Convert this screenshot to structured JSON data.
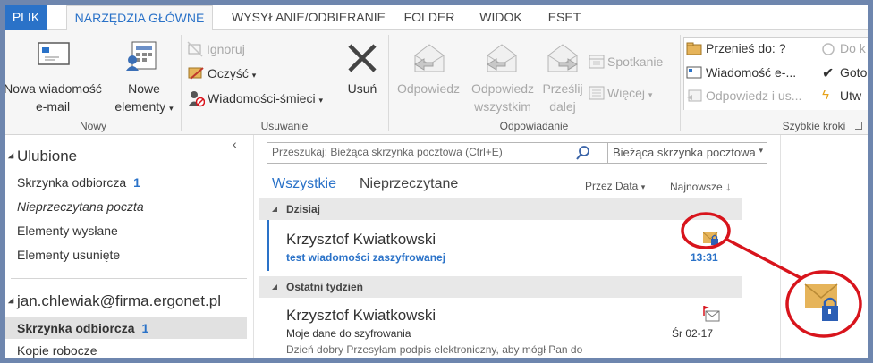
{
  "tabs": [
    "PLIK",
    "NARZĘDZIA GŁÓWNE",
    "WYSYŁANIE/ODBIERANIE",
    "FOLDER",
    "WIDOK",
    "ESET"
  ],
  "ribbon": {
    "new_mail": "Nowa wiadomość e-mail",
    "new_mail_line1": "Nowa wiadomość",
    "new_mail_line2": "e-mail",
    "new_items_line1": "Nowe",
    "new_items_line2": "elementy",
    "group_new": "Nowy",
    "ignore": "Ignoruj",
    "clean": "Oczyść",
    "junk": "Wiadomości-śmieci",
    "delete": "Usuń",
    "group_delete": "Usuwanie",
    "reply": "Odpowiedz",
    "reply_all_line1": "Odpowiedz",
    "reply_all_line2": "wszystkim",
    "forward_line1": "Prześlij",
    "forward_line2": "dalej",
    "meeting": "Spotkanie",
    "more": "Więcej",
    "group_respond": "Odpowiadanie",
    "qs_move": "Przenieś do: ?",
    "qs_message": "Wiadomość e-...",
    "qs_reply_delete": "Odpowiedz i us...",
    "qs_todo": "Do k",
    "qs_done": "Goto",
    "qs_create": "Utw",
    "group_quick": "Szybkie kroki"
  },
  "nav": {
    "favorites": "Ulubione",
    "inbox": "Skrzynka odbiorcza",
    "inbox_count": "1",
    "unread": "Nieprzeczytana poczta",
    "sent": "Elementy wysłane",
    "deleted": "Elementy usunięte",
    "account": "jan.chlewiak@firma.ergonet.pl",
    "acc_inbox": "Skrzynka odbiorcza",
    "acc_inbox_count": "1",
    "drafts": "Kopie robocze"
  },
  "list": {
    "search_placeholder": "Przeszukaj: Bieżąca skrzynka pocztowa (Ctrl+E)",
    "search_scope": "Bieżąca skrzynka pocztowa",
    "filter_all": "Wszystkie",
    "filter_unread": "Nieprzeczytane",
    "sort_by": "Przez Data",
    "sort_order": "Najnowsze",
    "group_today": "Dzisiaj",
    "group_lastweek": "Ostatni tydzień",
    "mails": [
      {
        "from": "Krzysztof Kwiatkowski",
        "subject": "test wiadomości zaszyfrowanej",
        "time": "13:31",
        "preview": ""
      },
      {
        "from": "Krzysztof Kwiatkowski",
        "subject": "Moje dane do szyfrowania",
        "time": "Śr 02-17",
        "preview": "Dzień dobry  Przesyłam podpis elektroniczny, aby mógł Pan do"
      }
    ]
  },
  "colors": {
    "accent": "#2a72c8",
    "annotation": "#d8141c",
    "envelope": "#e6b45a",
    "lock": "#2c5fb5"
  }
}
